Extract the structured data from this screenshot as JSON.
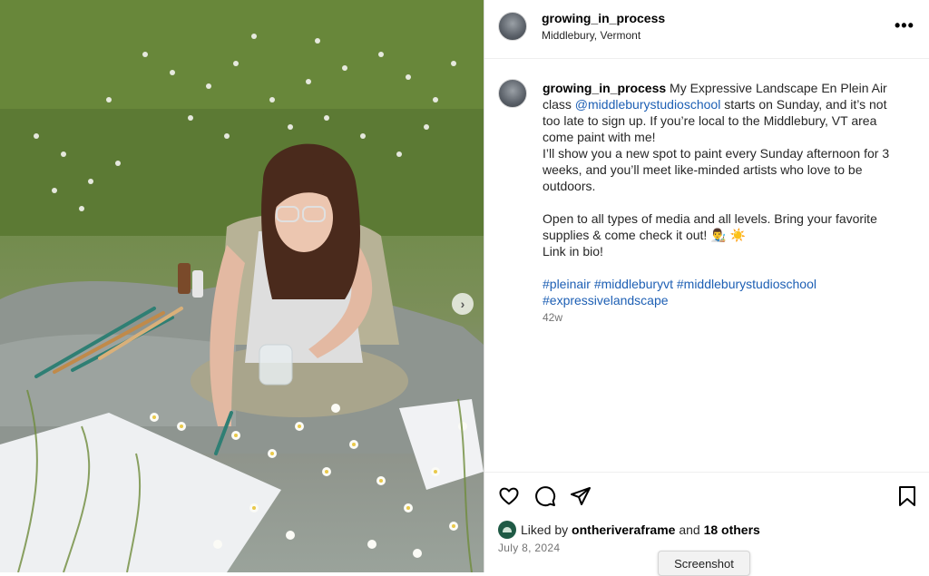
{
  "post": {
    "username": "growing_in_process",
    "location": "Middlebury, Vermont",
    "more_label": "•••",
    "caption": {
      "username": "growing_in_process",
      "text_1": " My Expressive Landscape En Plein Air class ",
      "mention": "@middleburystudioschool",
      "text_2": " starts on Sunday, and it’s not too late to sign up. If you’re local to the Middlebury, VT area come paint with me!",
      "line_2": "I’ll show you a new spot to paint every Sunday afternoon for 3 weeks, and you’ll meet like-minded artists who love to be outdoors.",
      "line_3": "Open to all types of media and all levels. Bring your favorite supplies & come check it out! 👨‍🎨 ☀️",
      "line_4": "Link in bio!",
      "hashtags": [
        "#pleinair",
        "#middleburyvt",
        "#middleburystudioschool",
        "#expressivelandscape"
      ]
    },
    "time_ago": "42w",
    "liked_by_prefix": "Liked by ",
    "liked_by_user": "ontheriveraframe",
    "liked_by_and": " and ",
    "liked_by_others": "18 others",
    "date": "July 8, 2024",
    "next_label": "›"
  },
  "icons": {
    "like": "heart-icon",
    "comment": "comment-icon",
    "share": "paper-plane-icon",
    "save": "bookmark-icon"
  },
  "tooltip": {
    "label": "Screenshot"
  },
  "colors": {
    "link": "#1d5fb4",
    "muted": "#737373",
    "divider": "#dbdbdb"
  }
}
